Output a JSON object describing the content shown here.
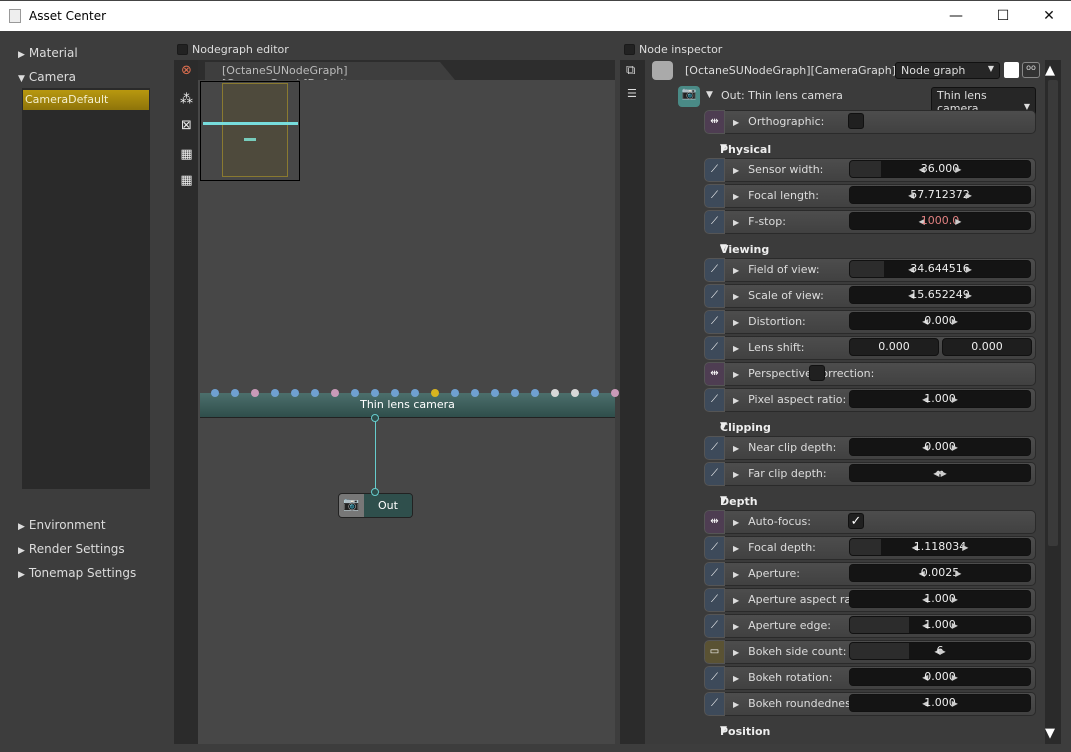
{
  "window": {
    "title": "Asset Center",
    "controls": [
      "—",
      "☐",
      "✕"
    ]
  },
  "tree": {
    "items": [
      {
        "label": "Material",
        "expanded": false
      },
      {
        "label": "Camera",
        "expanded": true
      },
      {
        "label": "Environment",
        "expanded": false
      },
      {
        "label": "Render Settings",
        "expanded": false
      },
      {
        "label": "Tonemap Settings",
        "expanded": false
      }
    ],
    "camera_children": [
      "CameraDefault"
    ],
    "selected": "CameraDefault"
  },
  "nodegraph": {
    "title": "Nodegraph editor",
    "tab": "[OctaneSUNodeGraph][CameraGraph]Default",
    "node": "Thin lens camera",
    "out_node": "Out",
    "pin_colors": [
      "#6fa0d0",
      "#6fa0d0",
      "#c99ab8",
      "#6fa0d0",
      "#6fa0d0",
      "#6fa0d0",
      "#c99ab8",
      "#6fa0d0",
      "#6fa0d0",
      "#6fa0d0",
      "#6fa0d0",
      "#d8b520",
      "#6fa0d0",
      "#6fa0d0",
      "#6fa0d0",
      "#6fa0d0",
      "#6fa0d0",
      "#d8d8d8",
      "#d8d8d8",
      "#6fa0d0",
      "#c99ab8"
    ]
  },
  "inspector": {
    "title": "Node inspector",
    "graph_name": "[OctaneSUNodeGraph][CameraGraph]Default",
    "graph_type": "Node graph",
    "out_label": "Out: Thin lens camera",
    "camera_type": "Thin lens camera",
    "rows": [
      {
        "kind": "bool",
        "label": "Orthographic:",
        "checked": false
      },
      {
        "kind": "header",
        "label": "Physical Camera parameters"
      },
      {
        "kind": "float",
        "label": "Sensor width:",
        "value": "36.000",
        "fill": 0.17
      },
      {
        "kind": "float",
        "label": "Focal length:",
        "value": "57.712372",
        "fill": 0
      },
      {
        "kind": "float",
        "label": "F-stop:",
        "value": "1000.0",
        "fill": 0,
        "color": "#e08080"
      },
      {
        "kind": "header",
        "label": "Viewing angle"
      },
      {
        "kind": "float",
        "label": "Field of view:",
        "value": "34.644516",
        "fill": 0.19
      },
      {
        "kind": "float",
        "label": "Scale of view:",
        "value": "15.652249",
        "fill": 0
      },
      {
        "kind": "float",
        "label": "Distortion:",
        "value": "0.000",
        "fill": 0
      },
      {
        "kind": "pair",
        "label": "Lens shift:",
        "values": [
          "0.000",
          "0.000"
        ]
      },
      {
        "kind": "bool",
        "label": "Perspective correction:",
        "checked": false,
        "cbx": 105
      },
      {
        "kind": "float",
        "label": "Pixel aspect ratio:",
        "value": "1.000",
        "fill": 0
      },
      {
        "kind": "header",
        "label": "Clipping"
      },
      {
        "kind": "float",
        "label": "Near clip depth:",
        "value": "0.000",
        "fill": 0
      },
      {
        "kind": "float",
        "label": "Far clip depth:",
        "value": "∞",
        "fill": 0
      },
      {
        "kind": "header",
        "label": "Depth of field"
      },
      {
        "kind": "bool",
        "label": "Auto-focus:",
        "checked": true
      },
      {
        "kind": "float",
        "label": "Focal depth:",
        "value": "1.118034",
        "fill": 0.17
      },
      {
        "kind": "float",
        "label": "Aperture:",
        "value": "0.0025",
        "fill": 0
      },
      {
        "kind": "float",
        "label": "Aperture aspect ratio:",
        "value": "1.000",
        "fill": 0
      },
      {
        "kind": "float",
        "label": "Aperture edge:",
        "value": "1.000",
        "fill": 0.33
      },
      {
        "kind": "int",
        "label": "Bokeh side count:",
        "value": "6",
        "fill": 0.33
      },
      {
        "kind": "float",
        "label": "Bokeh rotation:",
        "value": "0.000",
        "fill": 0
      },
      {
        "kind": "float",
        "label": "Bokeh roundedness:",
        "value": "1.000",
        "fill": 0
      },
      {
        "kind": "header",
        "label": "Position"
      }
    ]
  }
}
